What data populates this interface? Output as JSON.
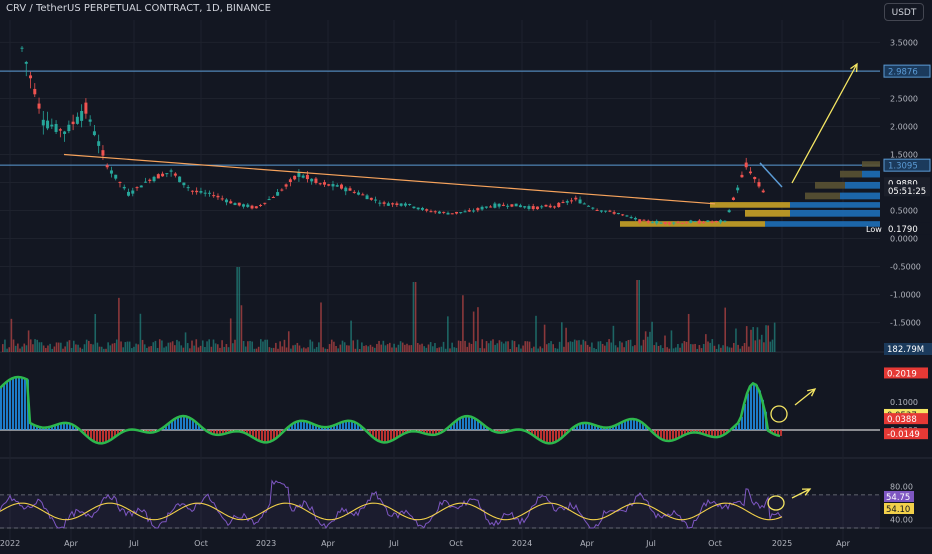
{
  "header": {
    "title": "CRV / TetherUS PERPETUAL CONTRACT, 1D, BINANCE",
    "currency": "USDT"
  },
  "colors": {
    "background": "#131722",
    "grid": "#1e222d",
    "up": "#26a69a",
    "down": "#ef5350",
    "trendline": "#f7a35c",
    "arrow": "#f5e663",
    "horizontal": "#5b9bd5",
    "vp_gold": "#c9a227",
    "vp_blue": "#1e6fb8",
    "vp_olive": "#5a5233",
    "rsi": "#7e57c2",
    "rsi_ma": "#f2d04a",
    "osc_green": "#2db84d",
    "osc_red": "#e53935",
    "osc_blue": "#2196f3"
  },
  "chart_data": {
    "type": "line",
    "x_ticks": [
      "2022",
      "Apr",
      "Jul",
      "Oct",
      "2023",
      "Apr",
      "Jul",
      "Oct",
      "2024",
      "Apr",
      "Jul",
      "Oct",
      "2025",
      "Apr"
    ],
    "price_axis": {
      "ticks": [
        "3.5000",
        "3.0000",
        "2.5000",
        "2.0000",
        "1.5000",
        "1.0000",
        "0.5000",
        "0.0000",
        "-0.5000",
        "-1.0000",
        "-1.5000"
      ],
      "ylim": [
        -1.9,
        3.9
      ]
    },
    "price": {
      "x": [
        "2022-01",
        "2022-02",
        "2022-03",
        "2022-04",
        "2022-05",
        "2022-06",
        "2022-07",
        "2022-08",
        "2022-09",
        "2022-10",
        "2022-11",
        "2022-12",
        "2023-01",
        "2023-02",
        "2023-03",
        "2023-04",
        "2023-05",
        "2023-06",
        "2023-07",
        "2023-08",
        "2023-09",
        "2023-10",
        "2023-11",
        "2023-12",
        "2024-01",
        "2024-02",
        "2024-03",
        "2024-04",
        "2024-05",
        "2024-06",
        "2024-07",
        "2024-08",
        "2024-09",
        "2024-10",
        "2024-11",
        "2024-12"
      ],
      "values": [
        3.4,
        2.1,
        1.9,
        2.3,
        1.3,
        0.8,
        1.05,
        1.2,
        0.85,
        0.78,
        0.62,
        0.55,
        0.8,
        1.15,
        0.98,
        0.92,
        0.78,
        0.62,
        0.62,
        0.5,
        0.45,
        0.48,
        0.58,
        0.6,
        0.55,
        0.58,
        0.7,
        0.52,
        0.45,
        0.32,
        0.28,
        0.29,
        0.3,
        0.3,
        1.3,
        0.73
      ]
    },
    "horizontal_levels": [
      2.9876,
      1.3095
    ],
    "price_labels": [
      {
        "text": "2.9876",
        "value": 2.9876,
        "color": "#5b9bd5"
      },
      {
        "text": "1.3095",
        "value": 1.3095,
        "color": "#5b9bd5"
      },
      {
        "text": "0.9880",
        "value": 0.988,
        "color": "#ffffff"
      },
      {
        "text": "05:51:25",
        "value": 0.86,
        "color": "#ffffff"
      },
      {
        "text": "0.1790",
        "value": 0.179,
        "color": "#ffffff"
      }
    ],
    "low_label": "Low",
    "volume_label": "182.79M",
    "oscillator": {
      "ticks": [
        "0.1000",
        "0.0000"
      ],
      "labels": [
        "0.2019",
        "0.0537",
        "0.0388",
        "-0.0149"
      ]
    },
    "rsi": {
      "ticks": [
        "80.00",
        "40.00"
      ],
      "labels": [
        "54.75",
        "54.10"
      ]
    }
  }
}
